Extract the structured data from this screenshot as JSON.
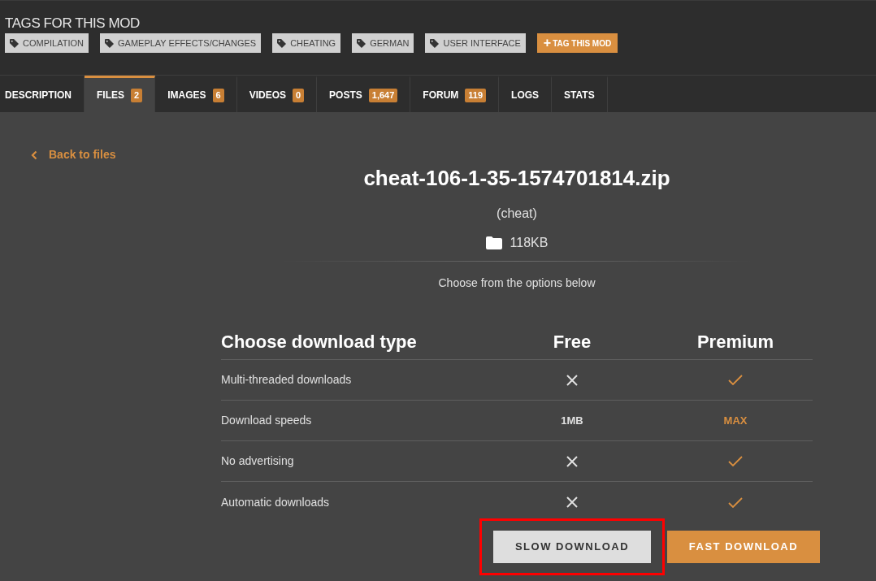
{
  "tags_section": {
    "heading": "TAGS FOR THIS MOD",
    "tags": [
      "COMPILATION",
      "GAMEPLAY EFFECTS/CHANGES",
      "CHEATING",
      "GERMAN",
      "USER INTERFACE"
    ],
    "add_button": {
      "icon": "+",
      "label": "TAG THIS MOD"
    }
  },
  "tabs": [
    {
      "label": "DESCRIPTION",
      "selected": false
    },
    {
      "label": "FILES",
      "count": "2",
      "selected": true
    },
    {
      "label": "IMAGES",
      "count": "6",
      "selected": false
    },
    {
      "label": "VIDEOS",
      "count": "0",
      "selected": false
    },
    {
      "label": "POSTS",
      "count": "1,647",
      "selected": false
    },
    {
      "label": "FORUM",
      "count": "119",
      "selected": false
    },
    {
      "label": "LOGS",
      "selected": false
    },
    {
      "label": "STATS",
      "selected": false
    }
  ],
  "back_link": "Back to files",
  "file": {
    "name": "cheat-106-1-35-1574701814.zip",
    "subtitle": "(cheat)",
    "size": "118KB"
  },
  "instructions": "Choose from the options below",
  "comparison": {
    "columns": [
      "Choose download type",
      "Free",
      "Premium"
    ],
    "rows": [
      {
        "label": "Multi-threaded downloads",
        "free": {
          "kind": "cross"
        },
        "premium": {
          "kind": "check"
        }
      },
      {
        "label": "Download speeds",
        "free": {
          "kind": "text",
          "text": "1MB"
        },
        "premium": {
          "kind": "text",
          "text": "MAX"
        }
      },
      {
        "label": "No advertising",
        "free": {
          "kind": "cross"
        },
        "premium": {
          "kind": "check"
        }
      },
      {
        "label": "Automatic downloads",
        "free": {
          "kind": "cross"
        },
        "premium": {
          "kind": "check"
        }
      }
    ]
  },
  "buttons": [
    {
      "label": "SLOW DOWNLOAD",
      "kind": "secondary",
      "highlighted": true
    },
    {
      "label": "FAST DOWNLOAD",
      "kind": "primary",
      "highlighted": false
    }
  ]
}
